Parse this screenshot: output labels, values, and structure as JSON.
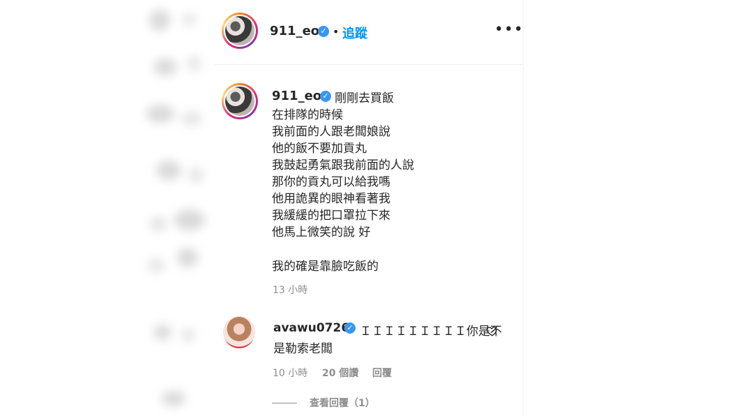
{
  "header": {
    "username": "911_eo",
    "separator": "•",
    "follow_label": "追蹤",
    "more_label": "•••"
  },
  "post": {
    "username": "911_eo",
    "caption_first": "剛剛去買飯",
    "caption_lines": [
      "在排隊的時候",
      "我前面的人跟老闆娘說",
      "他的飯不要加貢丸",
      "我鼓起勇氣跟我前面的人說",
      "那你的貢丸可以給我嗎",
      "他用詭異的眼神看著我",
      "我緩緩的把口罩拉下來",
      "他馬上微笑的說 好",
      "我的確是靠臉吃飯的"
    ],
    "time": "13 小時"
  },
  "comment": {
    "username": "avawu0726",
    "text_line1": "ＩＩＩＩＩＩＩＩＩ你是不",
    "text_line2": "是勒索老闆",
    "time": "10 小時",
    "likes": "20 個讚",
    "reply_label": "回覆",
    "view_replies": "查看回覆（1）"
  },
  "colors": {
    "accent": "#0095f6",
    "verified": "#3897f0",
    "muted": "#8e8e8e",
    "text": "#262626"
  },
  "icons": {
    "verified": "verified-badge-icon",
    "more": "more-options-icon",
    "like": "heart-icon"
  }
}
